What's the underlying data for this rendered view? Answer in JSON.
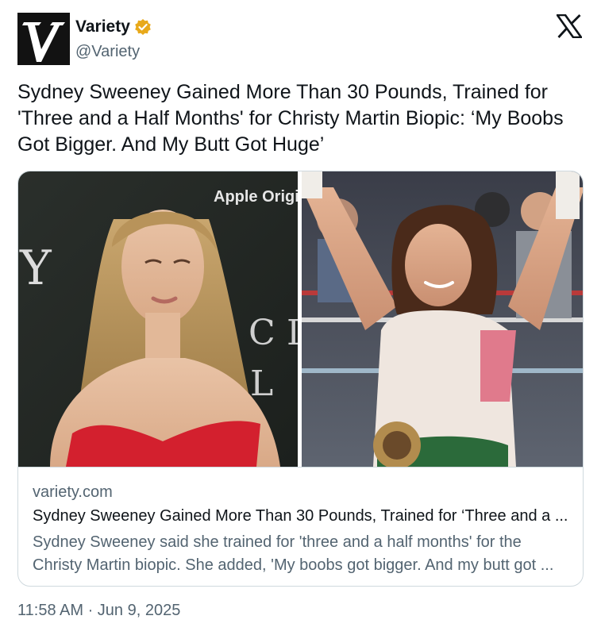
{
  "author": {
    "display_name": "Variety",
    "handle": "@Variety",
    "verified_icon": "gold-verified-badge-icon",
    "avatar_icon": "variety-v-logo",
    "badge_color": "#e8a91a"
  },
  "platform_icon": "x-logo-icon",
  "tweet": {
    "text": "Sydney Sweeney Gained More Than 30 Pounds, Trained for 'Three and a Half Months' for Christy Martin Biopic: ‘My Boobs Got Bigger. And My Butt Got Huge’"
  },
  "card": {
    "image_left_text": "Apple Origi",
    "domain": "variety.com",
    "title": "Sydney Sweeney Gained More Than 30 Pounds, Trained for ‘Three and a ...",
    "description": "Sydney Sweeney said she trained for 'three and a half months' for the Christy Martin biopic. She added, 'My boobs got bigger. And my butt got ..."
  },
  "timestamp": "11:58 AM · Jun 9, 2025"
}
